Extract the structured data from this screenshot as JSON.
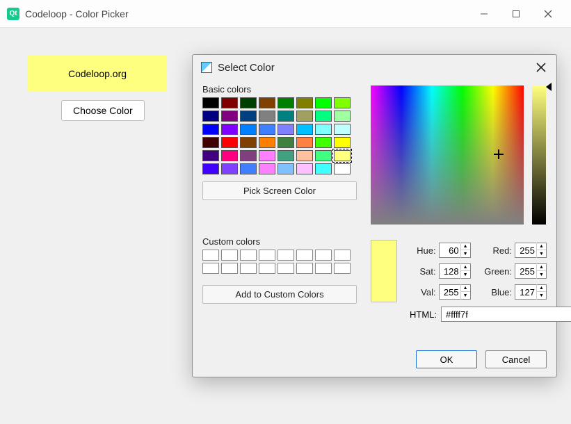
{
  "window": {
    "title": "Codeloop - Color Picker"
  },
  "main": {
    "label_text": "Codeloop.org",
    "choose_button": "Choose Color",
    "label_bg": "#ffff7f"
  },
  "dialog": {
    "title": "Select Color",
    "basic_label": "Basic colors",
    "custom_label": "Custom colors",
    "pick_screen": "Pick Screen Color",
    "add_custom": "Add to Custom Colors",
    "ok": "OK",
    "cancel": "Cancel",
    "basic_colors": [
      "#000000",
      "#800000",
      "#004000",
      "#804000",
      "#008000",
      "#808000",
      "#00ff00",
      "#80ff00",
      "#000080",
      "#800080",
      "#004080",
      "#808080",
      "#008080",
      "#a0a060",
      "#00ff80",
      "#a0ffa0",
      "#0000ff",
      "#8000ff",
      "#0080ff",
      "#4080ff",
      "#8080ff",
      "#00c0ff",
      "#80ffff",
      "#c0ffff",
      "#400000",
      "#ff0000",
      "#804000",
      "#ff8000",
      "#408040",
      "#ff8040",
      "#40ff00",
      "#ffff00",
      "#400080",
      "#ff0080",
      "#804080",
      "#ff80ff",
      "#40a080",
      "#ffc0a0",
      "#40ff80",
      "#ffff80",
      "#4000ff",
      "#8040ff",
      "#4080ff",
      "#ff80ff",
      "#80c0ff",
      "#ffc0ff",
      "#40ffff",
      "#ffffff"
    ],
    "selected_basic_index": 39,
    "custom_slots": 16,
    "hsv_labels": {
      "hue": "Hue:",
      "sat": "Sat:",
      "val": "Val:"
    },
    "rgb_labels": {
      "red": "Red:",
      "green": "Green:",
      "blue": "Blue:"
    },
    "hue": "60",
    "sat": "128",
    "val": "255",
    "red": "255",
    "green": "255",
    "blue": "127",
    "html_label": "HTML:",
    "html_value": "#ffff7f",
    "preview_color": "#ffff7f"
  }
}
